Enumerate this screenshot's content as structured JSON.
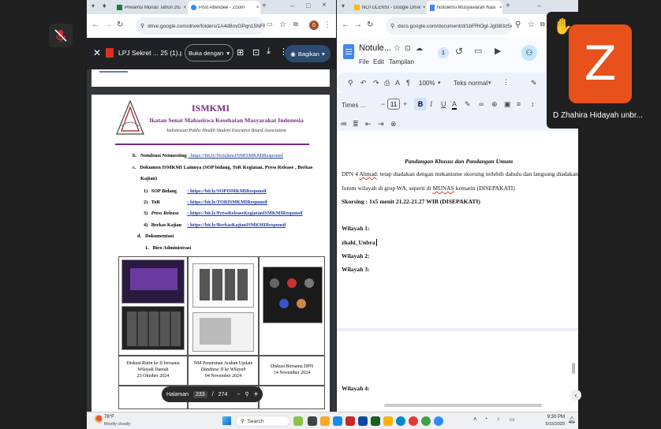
{
  "left_browser": {
    "tabs": [
      {
        "label": "Presensi Munas Tahun 202",
        "icon": "sheets-icon",
        "color": "#188038"
      },
      {
        "label": "Post Attendee - Zoom",
        "icon": "zoom-icon",
        "color": "#2d8cff"
      }
    ],
    "new_tab": "+",
    "window_controls": [
      "–",
      "□",
      "×"
    ],
    "url": "drive.google.com/drive/folders/1A4d8ovGPqn15NFR46l...",
    "profile_badge": "0",
    "pdf_viewer": {
      "title": "LPJ Sekret ... 25 (1).pdf",
      "open_with_label": "Buka dengan",
      "share_label": "Bagikan"
    },
    "document": {
      "org_acronym": "ISMKMI",
      "org_name": "Ikatan Senat Mahasiswa Kesehatan Masyarakat Indonesia",
      "org_tagline": "Indonesian Public Health Student Executive Board Association",
      "items": [
        {
          "letter": "b.",
          "label": "Notulensi Netmeeting",
          "link": ": https://bit.ly/NotulensiNMISMKMIResponsif"
        },
        {
          "letter": "c.",
          "label": "Dokumen ISMKMI Lainnya (SOP bidang, ToR Kegiatan, Press Release , Berkas",
          "cont": "Kajian)"
        }
      ],
      "subitems": [
        {
          "num": "1)",
          "label": "SOP Bidang",
          "link": ": https://bit.ly/SOPISMKMIResponsif"
        },
        {
          "num": "2)",
          "label": "ToR",
          "link": ": https://bit.ly/TORISMKMIResponsif"
        },
        {
          "num": "3)",
          "label": "Press Release",
          "link": ": https://bit.ly/PressReleaseKegiatanISMKMIResponsif"
        },
        {
          "num": "4)",
          "label": "Berkas Kajian",
          "link": ": https://bit.ly/BerkasKajianISMKMIResponsif"
        }
      ],
      "doc_heading": {
        "letter": "d.",
        "label": "Dokumentasi"
      },
      "doc_sub": {
        "num": "1.",
        "label": "Biro Administrasi"
      },
      "captions": [
        [
          "Diskusi Rutin ke II bersama",
          "Wilayah Daerah",
          "23 Oktober 2024"
        ],
        [
          "NM Penurunan Arahan Update",
          "Database II ke Wilayah",
          "04 November 2024"
        ],
        [
          "Diskusi Bersama DPN",
          "14 November 2024"
        ]
      ]
    },
    "pager": {
      "label": "Halaman",
      "current": "233",
      "sep": "/",
      "total": "274"
    }
  },
  "right_browser": {
    "tabs": [
      {
        "label": "NOTULENSI - Google Drive",
        "icon": "drive-icon",
        "color": "#fbbc04"
      },
      {
        "label": "Notulensi Musyawarah Nasi",
        "icon": "docs-icon",
        "color": "#4285f4"
      }
    ],
    "url": "docs.google.com/document/d/1bFRlOgI-Jgl383z5xb...",
    "doc_title": "Notule...",
    "menus": [
      "File",
      "Edit",
      "Tampilan"
    ],
    "toolbar": {
      "zoom": "100%",
      "style": "Teks normal",
      "font": "Times ...",
      "size": "11",
      "avatar_count": "1"
    },
    "content": {
      "heading": "Pandangan Khusus dan Pandangan Umum",
      "para_1a": "DPN 4 ",
      "para_1_name": "Ahmad",
      "para_1b": ": tetap diadakan dengan mekanisme skorsing terlebih dahulu dan langsung diadakan",
      "para_2a": "forum wilayah di grup WA, seperti di ",
      "para_2_munas": "MUNAS",
      "para_2b": " kemarin (DISEPAKATI)",
      "skorsing": "Skorsing : 1x5 menit 21.22-21.27 WIB (DISEPAKATI)",
      "wilayah_1": "Wilayah 1:",
      "typed": "zhahi_Unbra",
      "wilayah_2": "Wilayah 2:",
      "wilayah_3": "Wilayah 3:",
      "wilayah_4": "Wilayah 4:"
    }
  },
  "participant": {
    "initial": "Z",
    "name": "D Zhahira Hidayah unbr..."
  },
  "taskbar": {
    "temp": "78°F",
    "weather": "Mostly cloudy",
    "search": "Search",
    "time": "9:30 PM",
    "date": "5/15/2025"
  }
}
